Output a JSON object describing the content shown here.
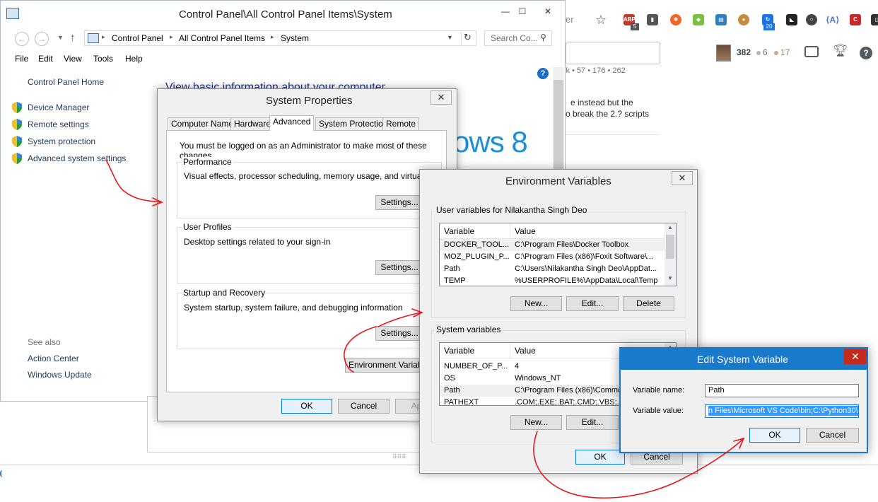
{
  "browser": {
    "address_tail": "er",
    "so": {
      "reputation": "382",
      "silver": "6",
      "bronze": "17",
      "badge_row": "ik • 57 • 176 • 262",
      "text_line1": "e instead but the",
      "text_line2": "o break the 2.? scripts",
      "notify_badge": "5",
      "notify_badge2": "20"
    }
  },
  "control_panel": {
    "title": "Control Panel\\All Control Panel Items\\System",
    "breadcrumbs": [
      "Control Panel",
      "All Control Panel Items",
      "System"
    ],
    "search_placeholder": "Search Co...",
    "menu": [
      "File",
      "Edit",
      "View",
      "Tools",
      "Help"
    ],
    "home_link": "Control Panel Home",
    "tasks": [
      "Device Manager",
      "Remote settings",
      "System protection",
      "Advanced system settings"
    ],
    "see_also_label": "See also",
    "see_also": [
      "Action Center",
      "Windows Update"
    ],
    "heading": "View basic information about your computer",
    "windows_logo": "ows 8"
  },
  "system_properties": {
    "title": "System Properties",
    "tabs": [
      "Computer Name",
      "Hardware",
      "Advanced",
      "System Protection",
      "Remote"
    ],
    "active_tab": "Advanced",
    "admin_note": "You must be logged on as an Administrator to make most of these changes.",
    "performance": {
      "title": "Performance",
      "description": "Visual effects, processor scheduling, memory usage, and virtual memor",
      "button": "Settings..."
    },
    "user_profiles": {
      "title": "User Profiles",
      "description": "Desktop settings related to your sign-in",
      "button": "Settings..."
    },
    "startup_recovery": {
      "title": "Startup and Recovery",
      "description": "System startup, system failure, and debugging information",
      "button": "Settings..."
    },
    "env_button": "Environment Variable",
    "ok": "OK",
    "cancel": "Cancel",
    "apply": "Ap"
  },
  "environment_variables": {
    "title": "Environment Variables",
    "user_group": "User variables for Nilakantha Singh Deo",
    "col_variable": "Variable",
    "col_value": "Value",
    "user_vars": [
      {
        "name": "DOCKER_TOOL...",
        "value": "C:\\Program Files\\Docker Toolbox"
      },
      {
        "name": "MOZ_PLUGIN_P...",
        "value": "C:\\Program Files (x86)\\Foxit Software\\..."
      },
      {
        "name": "Path",
        "value": "C:\\Users\\Nilakantha Singh Deo\\AppDat..."
      },
      {
        "name": "TEMP",
        "value": "%USERPROFILE%\\AppData\\Local\\Temp"
      }
    ],
    "user_buttons": {
      "new": "New...",
      "edit": "Edit...",
      "delete": "Delete"
    },
    "system_group": "System variables",
    "system_vars": [
      {
        "name": "NUMBER_OF_P...",
        "value": "4"
      },
      {
        "name": "OS",
        "value": "Windows_NT"
      },
      {
        "name": "Path",
        "value": "C:\\Program Files (x86)\\Commo"
      },
      {
        "name": "PATHEXT",
        "value": ".COM;.EXE;.BAT;.CMD;.VBS;.V"
      }
    ],
    "system_buttons": {
      "new": "New...",
      "edit": "Edit..."
    },
    "ok": "OK",
    "cancel": "Cancel"
  },
  "edit_system_variable": {
    "title": "Edit System Variable",
    "name_label": "Variable name:",
    "name_value": "Path",
    "value_label": "Variable value:",
    "value_value": "n Files\\Microsoft VS Code\\bin;C:\\Python30\\",
    "ok": "OK",
    "cancel": "Cancel"
  },
  "colors": {
    "annotation": "#e8161a",
    "link": "#1e395b",
    "accent": "#1979ca",
    "windows_blue": "#1a8fd8"
  }
}
